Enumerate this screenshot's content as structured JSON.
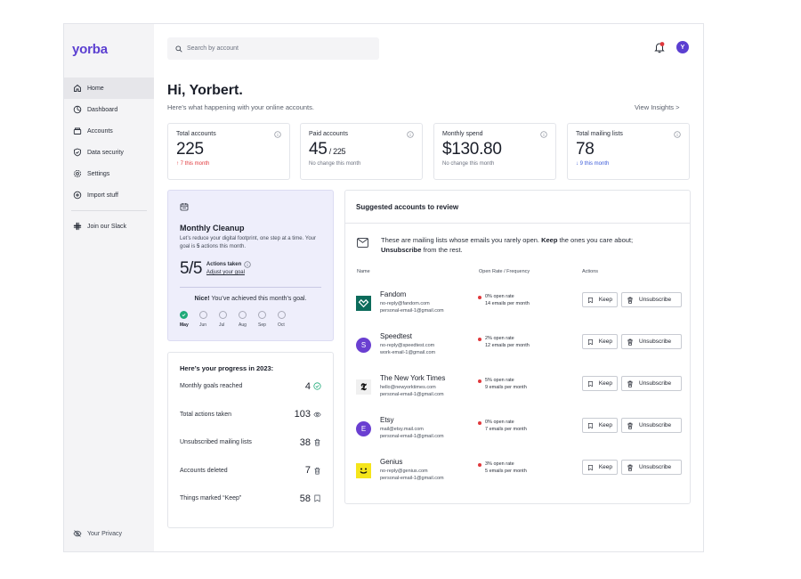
{
  "app": {
    "logo": "yorba"
  },
  "sidebar": {
    "items": [
      {
        "label": "Home",
        "icon": "home-icon",
        "active": true
      },
      {
        "label": "Dashboard",
        "icon": "dashboard-icon"
      },
      {
        "label": "Accounts",
        "icon": "accounts-icon"
      },
      {
        "label": "Data security",
        "icon": "shield-icon"
      },
      {
        "label": "Settings",
        "icon": "gear-icon"
      },
      {
        "label": "Import stuff",
        "icon": "plus-circle-icon"
      }
    ],
    "slack": {
      "label": "Join our Slack",
      "icon": "slack-icon"
    },
    "privacy": {
      "label": "Your Privacy",
      "icon": "eye-off-icon"
    }
  },
  "header": {
    "search_placeholder": "Search by account",
    "avatar_initial": "Y",
    "notification_color": "#e0383c"
  },
  "greeting": {
    "title": "Hi, Yorbert.",
    "subtitle": "Here’s what happening with your online accounts.",
    "insights_link": "View Insights  >"
  },
  "stats": [
    {
      "label": "Total accounts",
      "value": "225",
      "suffix": "",
      "note": "↑ 7 this month",
      "note_style": "red"
    },
    {
      "label": "Paid accounts",
      "value": "45",
      "suffix": " / 225",
      "note": "No change this month",
      "note_style": ""
    },
    {
      "label": "Monthly spend",
      "value": "$130.80",
      "suffix": "",
      "note": "No change this month",
      "note_style": ""
    },
    {
      "label": "Total mailing lists",
      "value": "78",
      "suffix": "",
      "note": "↓ 9 this month",
      "note_style": "blue"
    }
  ],
  "cleanup": {
    "title": "Monthly Cleanup",
    "desc_1": "Let’s reduce your digital footprint, one step at a time. Your goal is ",
    "desc_goal": "5",
    "desc_2": " actions this month.",
    "progress_value": "5/5",
    "actions_label": "Actions taken",
    "adjust_link": "Adjust your goal",
    "nice_bold": "Nice!",
    "nice_text": " You’ve achieved this month’s goal.",
    "months": [
      {
        "label": "May",
        "done": true
      },
      {
        "label": "Jun",
        "done": false
      },
      {
        "label": "Jul",
        "done": false
      },
      {
        "label": "Aug",
        "done": false
      },
      {
        "label": "Sep",
        "done": false
      },
      {
        "label": "Oct",
        "done": false
      }
    ]
  },
  "progress": {
    "title": "Here’s your progress in 2023:",
    "rows": [
      {
        "label": "Monthly goals reached",
        "value": "4",
        "icon": "check-circle-icon"
      },
      {
        "label": "Total actions taken",
        "value": "103",
        "icon": "eye-icon"
      },
      {
        "label": "Unsubscribed mailing lists",
        "value": "38",
        "icon": "trash-icon"
      },
      {
        "label": "Accounts deleted",
        "value": "7",
        "icon": "trash-icon"
      },
      {
        "label": "Things marked “Keep”",
        "value": "58",
        "icon": "bookmark-icon"
      }
    ]
  },
  "suggested": {
    "title": "Suggested accounts to review",
    "desc_1": "These are mailing lists whose emails you rarely open. ",
    "desc_keep": "Keep",
    "desc_2": " the ones you care about; ",
    "desc_unsub": "Unsubscribe",
    "desc_3": " from the rest.",
    "columns": {
      "name": "Name",
      "rate": "Open Rate / Frequency",
      "actions": "Actions"
    },
    "keep_label": "Keep",
    "unsub_label": "Unsubscribe",
    "accounts": [
      {
        "name": "Fandom",
        "email_1": "no-reply@fandom.com",
        "email_2": "personal-email-1@gmail.com",
        "rate": "0% open rate",
        "freq": "14 emails per month",
        "logo": "fandom-logo",
        "logo_color": "#0c6b5b"
      },
      {
        "name": "Speedtest",
        "email_1": "no-reply@speedtest.com",
        "email_2": "work-email-1@gmail.com",
        "rate": "2% open rate",
        "freq": "12 emails per month",
        "logo_text": "S",
        "logo_color": "#6a3fd1"
      },
      {
        "name": "The New York Times",
        "email_1": "hello@newyorktimes.com",
        "email_2": "personal-email-1@gmail.com",
        "rate": "5% open rate",
        "freq": "9 emails per month",
        "logo_text": "𝕿",
        "logo_color": "#f0f0f0"
      },
      {
        "name": "Etsy",
        "email_1": "mail@etsy.mail.com",
        "email_2": "personal-email-1@gmail.com",
        "rate": "0% open rate",
        "freq": "7 emails per month",
        "logo_text": "E",
        "logo_color": "#6a3fd1"
      },
      {
        "name": "Genius",
        "email_1": "no-reply@genius.com",
        "email_2": "personal-email-1@gmail.com",
        "rate": "3% open rate",
        "freq": "5 emails per month",
        "logo": "genius-logo",
        "logo_color": "#f5e51b"
      }
    ]
  }
}
